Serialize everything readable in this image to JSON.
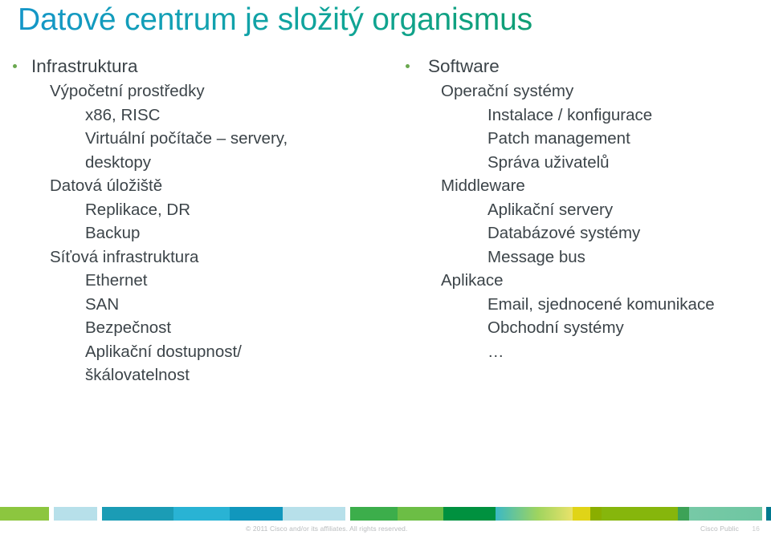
{
  "slide": {
    "title": "Datové centrum je složitý organismus",
    "title_gradient_from": "#1496c8",
    "title_gradient_to": "#0f9960",
    "body_text_color": "#3c4449",
    "bullet_color": "#6aa84f",
    "background": "#ffffff"
  },
  "columns": [
    {
      "id": "left",
      "lines": [
        {
          "level": 0,
          "bullet": true,
          "text": "Infrastruktura"
        },
        {
          "level": 1,
          "bullet": false,
          "text": "Výpočetní prostředky"
        },
        {
          "level": 2,
          "bullet": false,
          "text": "x86, RISC"
        },
        {
          "level": 2,
          "bullet": false,
          "text": "Virtuální počítače – servery, desktopy"
        },
        {
          "level": 1,
          "bullet": false,
          "text": "Datová úložiště"
        },
        {
          "level": 2,
          "bullet": false,
          "text": "Replikace, DR"
        },
        {
          "level": 2,
          "bullet": false,
          "text": "Backup"
        },
        {
          "level": 1,
          "bullet": false,
          "text": "Síťová infrastruktura"
        },
        {
          "level": 2,
          "bullet": false,
          "text": "Ethernet"
        },
        {
          "level": 2,
          "bullet": false,
          "text": "SAN"
        },
        {
          "level": 2,
          "bullet": false,
          "text": "Bezpečnost"
        },
        {
          "level": 2,
          "bullet": false,
          "text": "Aplikační dostupnost/škálovatelnost"
        }
      ]
    },
    {
      "id": "right",
      "lines": [
        {
          "level": 0,
          "bullet": true,
          "text": "Software"
        },
        {
          "level": 1,
          "bullet": false,
          "text": "Operační systémy"
        },
        {
          "level": 2,
          "bullet": false,
          "text": "Instalace / konfigurace"
        },
        {
          "level": 2,
          "bullet": false,
          "text": "Patch management"
        },
        {
          "level": 2,
          "bullet": false,
          "text": "Správa uživatelů"
        },
        {
          "level": 1,
          "bullet": false,
          "text": "Middleware"
        },
        {
          "level": 2,
          "bullet": false,
          "text": "Aplikační servery"
        },
        {
          "level": 2,
          "bullet": false,
          "text": "Databázové systémy"
        },
        {
          "level": 2,
          "bullet": false,
          "text": "Message bus"
        },
        {
          "level": 1,
          "bullet": false,
          "text": "Aplikace"
        },
        {
          "level": 2,
          "bullet": false,
          "text": "Email, sjednocené komunikace"
        },
        {
          "level": 2,
          "bullet": false,
          "text": "Obchodní systémy"
        },
        {
          "level": 2,
          "bullet": false,
          "text": "…"
        }
      ]
    }
  ],
  "footer": {
    "copyright": "© 2011 Cisco and/or its affiliates. All rights reserved.",
    "classification": "Cisco Public",
    "page_number": "16",
    "bar_segments": [
      {
        "color": "#8cc63f",
        "width": 7.0
      },
      {
        "color": "#ffffff",
        "width": 0.7
      },
      {
        "color": "#b7e0ea",
        "width": 6.2
      },
      {
        "color": "#ffffff",
        "width": 0.7
      },
      {
        "color": "#1b9cb5",
        "width": 10.2
      },
      {
        "color": "#29b3d4",
        "width": 8.0
      },
      {
        "color": "#1197bd",
        "width": 7.6
      },
      {
        "color": "#b7e0ea",
        "width": 9.0
      },
      {
        "color": "#ffffff",
        "width": 0.7
      },
      {
        "color": "#3cae4b",
        "width": 6.8
      },
      {
        "color": "#6cbe45",
        "width": 6.5
      },
      {
        "color": "#00913f",
        "width": 7.5
      },
      {
        "color": "#3bb9c4",
        "width": 11.0
      },
      {
        "color": "#e0d417",
        "width": 2.6
      },
      {
        "color": "#8aae00",
        "width": 1.5
      },
      {
        "color": "#86b60c",
        "width": 11.0
      },
      {
        "color": "#3da257",
        "width": 1.6
      },
      {
        "color": "#77c9a6",
        "width": 10.4
      },
      {
        "color": "#ffffff",
        "width": 0.6
      },
      {
        "color": "#00798f",
        "width": 0.7
      }
    ]
  }
}
